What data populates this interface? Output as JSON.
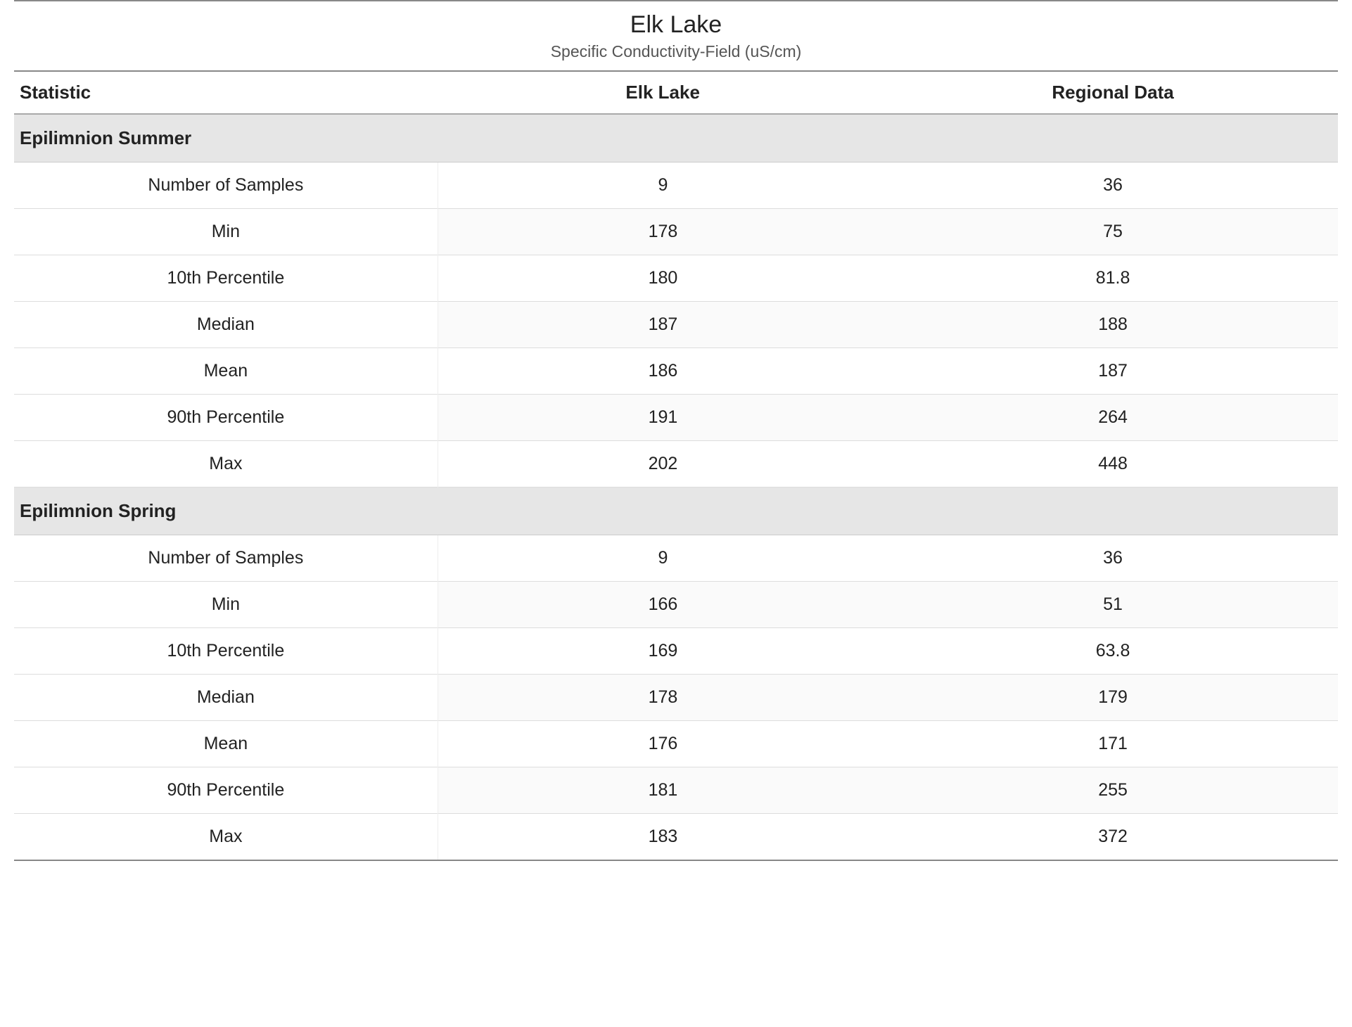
{
  "title": "Elk Lake",
  "subtitle": "Specific Conductivity-Field (uS/cm)",
  "columns": {
    "stat": "Statistic",
    "col1": "Elk Lake",
    "col2": "Regional Data"
  },
  "stat_labels": [
    "Number of Samples",
    "Min",
    "10th Percentile",
    "Median",
    "Mean",
    "90th Percentile",
    "Max"
  ],
  "sections": [
    {
      "name": "Epilimnion Summer",
      "rows": [
        {
          "c1": "9",
          "c2": "36"
        },
        {
          "c1": "178",
          "c2": "75"
        },
        {
          "c1": "180",
          "c2": "81.8"
        },
        {
          "c1": "187",
          "c2": "188"
        },
        {
          "c1": "186",
          "c2": "187"
        },
        {
          "c1": "191",
          "c2": "264"
        },
        {
          "c1": "202",
          "c2": "448"
        }
      ]
    },
    {
      "name": "Epilimnion Spring",
      "rows": [
        {
          "c1": "9",
          "c2": "36"
        },
        {
          "c1": "166",
          "c2": "51"
        },
        {
          "c1": "169",
          "c2": "63.8"
        },
        {
          "c1": "178",
          "c2": "179"
        },
        {
          "c1": "176",
          "c2": "171"
        },
        {
          "c1": "181",
          "c2": "255"
        },
        {
          "c1": "183",
          "c2": "372"
        }
      ]
    }
  ]
}
